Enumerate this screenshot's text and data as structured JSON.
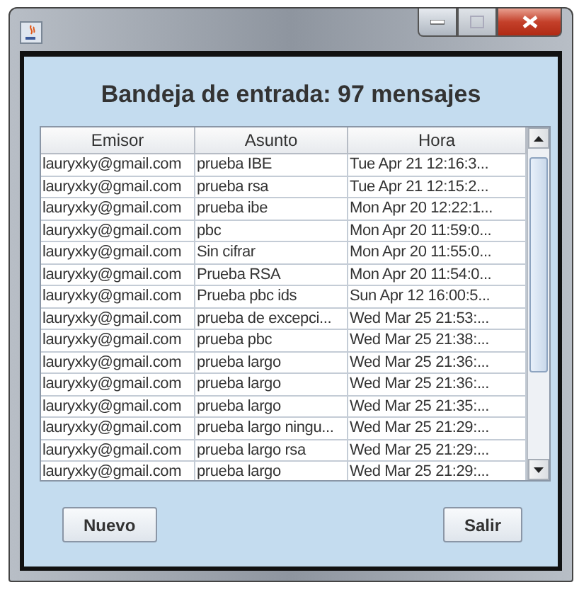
{
  "heading": "Bandeja de entrada: 97 mensajes",
  "table": {
    "columns": [
      "Emisor",
      "Asunto",
      "Hora"
    ],
    "rows": [
      [
        "lauryxky@gmail.com",
        "prueba IBE",
        "Tue Apr 21 12:16:3..."
      ],
      [
        "lauryxky@gmail.com",
        "prueba rsa",
        "Tue Apr 21 12:15:2..."
      ],
      [
        "lauryxky@gmail.com",
        "prueba ibe",
        "Mon Apr 20 12:22:1..."
      ],
      [
        "lauryxky@gmail.com",
        "pbc",
        "Mon Apr 20 11:59:0..."
      ],
      [
        "lauryxky@gmail.com",
        "Sin cifrar",
        "Mon Apr 20 11:55:0..."
      ],
      [
        "lauryxky@gmail.com",
        "Prueba RSA",
        "Mon Apr 20 11:54:0..."
      ],
      [
        "lauryxky@gmail.com",
        "Prueba pbc ids",
        "Sun Apr 12 16:00:5..."
      ],
      [
        "lauryxky@gmail.com",
        "prueba de excepci...",
        "Wed Mar 25 21:53:..."
      ],
      [
        "lauryxky@gmail.com",
        "prueba pbc",
        "Wed Mar 25 21:38:..."
      ],
      [
        "lauryxky@gmail.com",
        "prueba largo",
        "Wed Mar 25 21:36:..."
      ],
      [
        "lauryxky@gmail.com",
        "prueba largo",
        "Wed Mar 25 21:36:..."
      ],
      [
        "lauryxky@gmail.com",
        "prueba largo",
        "Wed Mar 25 21:35:..."
      ],
      [
        "lauryxky@gmail.com",
        "prueba largo ningu...",
        "Wed Mar 25 21:29:..."
      ],
      [
        "lauryxky@gmail.com",
        "prueba largo rsa",
        "Wed Mar 25 21:29:..."
      ],
      [
        "lauryxky@gmail.com",
        "prueba largo",
        "Wed Mar 25 21:29:..."
      ]
    ]
  },
  "buttons": [
    "Nuevo",
    "Salir"
  ]
}
